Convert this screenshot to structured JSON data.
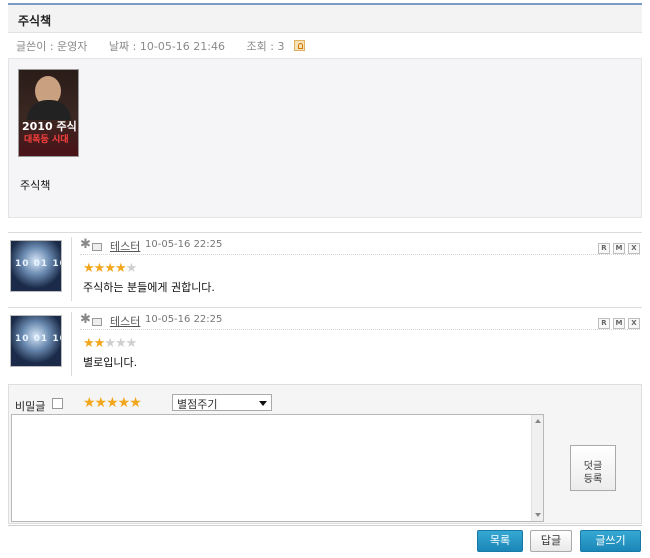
{
  "post": {
    "title": "주식책",
    "author_label": "글쓴이 : 운영자",
    "date_label": "날짜 : 10-05-16 21:46",
    "views_label": "조회 : 3",
    "book_cover_line1": "2010 주식",
    "book_cover_line2": "대폭등 시대",
    "body": "주식책"
  },
  "comments": [
    {
      "author": "테스터",
      "time": "10-05-16 22:25",
      "rating": 3.5,
      "text": "주식하는 분들에게 권합니다.",
      "buttons": [
        "R",
        "M",
        "X"
      ]
    },
    {
      "author": "테스터",
      "time": "10-05-16 22:25",
      "rating": 2,
      "text": "별로입니다.",
      "buttons": [
        "R",
        "M",
        "X"
      ]
    }
  ],
  "comment_form": {
    "secret_label": "비밀글",
    "rating_placeholder": "별점주기",
    "submit_label": "덧글\n등록",
    "textarea_value": ""
  },
  "bottom_buttons": {
    "list": "목록",
    "reply": "답글",
    "write": "글쓰기"
  },
  "colors": {
    "star_on": "#f2a61c",
    "star_off": "#cfcfcf",
    "button_blue": "#1b86b8",
    "title_bar_line": "#7a9cc4"
  }
}
